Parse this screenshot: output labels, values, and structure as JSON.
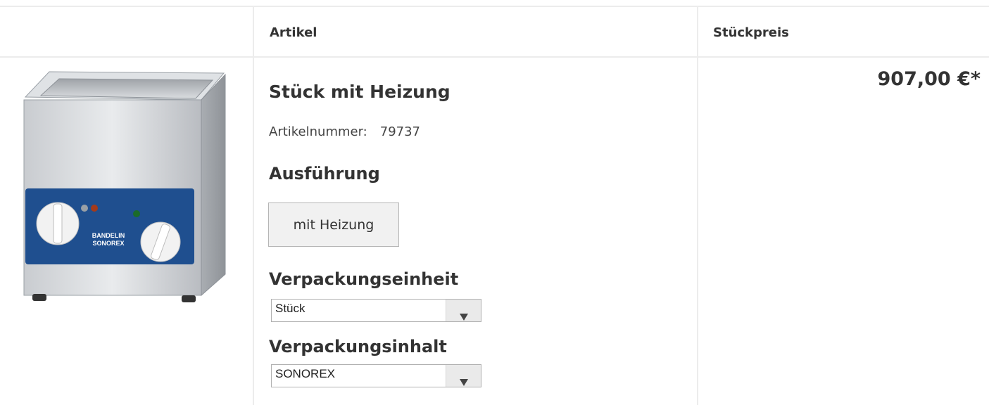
{
  "table": {
    "col_article": "Artikel",
    "col_unit_price": "Stückpreis"
  },
  "product": {
    "image_icon": "ultrasonic-bath-image",
    "image_brand_text": "BANDELIN SONOREX",
    "title": "Stück mit Heizung",
    "article_number_label": "Artikelnummer:",
    "article_number": "79737",
    "variant_heading": "Ausführung",
    "variant_option": "mit Heizung",
    "packaging_unit_heading": "Verpackungseinheit",
    "packaging_unit_value": "Stück",
    "packaging_content_heading": "Verpackungsinhalt",
    "packaging_content_value": "SONOREX",
    "price": "907,00 €*"
  },
  "colors": {
    "panel_blue": "#1f4f8f",
    "border": "#ececec"
  }
}
